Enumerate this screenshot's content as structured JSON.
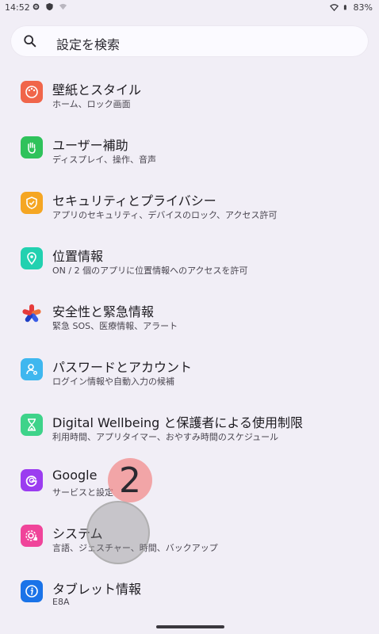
{
  "status_bar": {
    "time": "14:52",
    "battery": "83%"
  },
  "search": {
    "placeholder": "設定を検索"
  },
  "items": [
    {
      "title": "壁紙とスタイル",
      "subtitle": "ホーム、ロック画面",
      "icon": "palette-icon",
      "color": "#f0654a"
    },
    {
      "title": "ユーザー補助",
      "subtitle": "ディスプレイ、操作、音声",
      "icon": "hand-icon",
      "color": "#2fc25b"
    },
    {
      "title": "セキュリティとプライバシー",
      "subtitle": "アプリのセキュリティ、デバイスのロック、アクセス許可",
      "icon": "shield-icon",
      "color": "#f5a623"
    },
    {
      "title": "位置情報",
      "subtitle": "ON / 2 個のアプリに位置情報へのアクセスを許可",
      "icon": "location-pin-icon",
      "color": "#22d1b0"
    },
    {
      "title": "安全性と緊急情報",
      "subtitle": "緊急 SOS、医療情報、アラート",
      "icon": "emergency-asterisk-icon",
      "color": "#e63b3b"
    },
    {
      "title": "パスワードとアカウント",
      "subtitle": "ログイン情報や自動入力の候補",
      "icon": "account-icon",
      "color": "#3fb7ef"
    },
    {
      "title": "Digital Wellbeing と保護者による使用制限",
      "subtitle": "利用時間、アプリタイマー、おやすみ時間のスケジュール",
      "icon": "hourglass-icon",
      "color": "#3ed38a"
    },
    {
      "title": "Google",
      "subtitle": "サービスと設定",
      "icon": "google-icon",
      "color": "#9b3cf0"
    },
    {
      "title": "システム",
      "subtitle": "言語、ジェスチャー、時間、バックアップ",
      "icon": "system-gear-icon",
      "color": "#f0449a"
    },
    {
      "title": "タブレット情報",
      "subtitle": "E8A",
      "icon": "info-icon",
      "color": "#1a73e8"
    }
  ],
  "overlay": {
    "badge": "2"
  }
}
